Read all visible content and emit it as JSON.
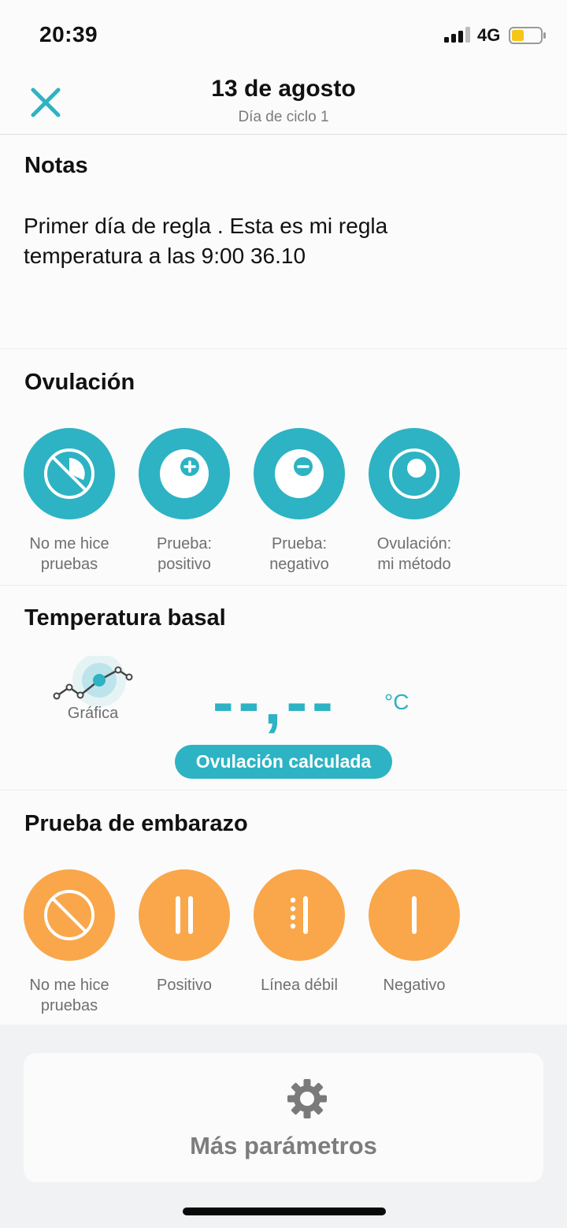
{
  "status_bar": {
    "time": "20:39",
    "network": "4G",
    "battery_color": "#f5c518"
  },
  "header": {
    "title": "13 de agosto",
    "subtitle": "Día de ciclo 1",
    "close_icon": "close-x-icon"
  },
  "notes": {
    "title": "Notas",
    "lines": [
      "Primer día de regla . Esta es mi regla",
      "temperatura a las 9:00 36.10"
    ]
  },
  "ovulation": {
    "title": "Ovulación",
    "color": "#2db3c3",
    "options": [
      {
        "line1": "No me hice",
        "line2": "pruebas",
        "icon": "no-test-icon"
      },
      {
        "line1": "Prueba:",
        "line2": "positivo",
        "icon": "positive-test-icon"
      },
      {
        "line1": "Prueba:",
        "line2": "negativo",
        "icon": "negative-test-icon"
      },
      {
        "line1": "Ovulación:",
        "line2": "mi método",
        "icon": "my-method-icon"
      }
    ]
  },
  "basal_temperature": {
    "title": "Temperatura basal",
    "chart_label": "Gráfica",
    "value": "--,--",
    "unit": "°C",
    "badge": "Ovulación calculada"
  },
  "pregnancy_test": {
    "title": "Prueba de embarazo",
    "color": "#f9a74a",
    "options": [
      {
        "line1": "No me hice",
        "line2": "pruebas",
        "icon": "no-test-icon"
      },
      {
        "line1": "Positivo",
        "line2": "",
        "icon": "two-lines-icon"
      },
      {
        "line1": "Línea débil",
        "line2": "",
        "icon": "faint-line-icon"
      },
      {
        "line1": "Negativo",
        "line2": "",
        "icon": "one-line-icon"
      }
    ]
  },
  "more": {
    "label": "Más parámetros",
    "icon": "gear-icon"
  }
}
